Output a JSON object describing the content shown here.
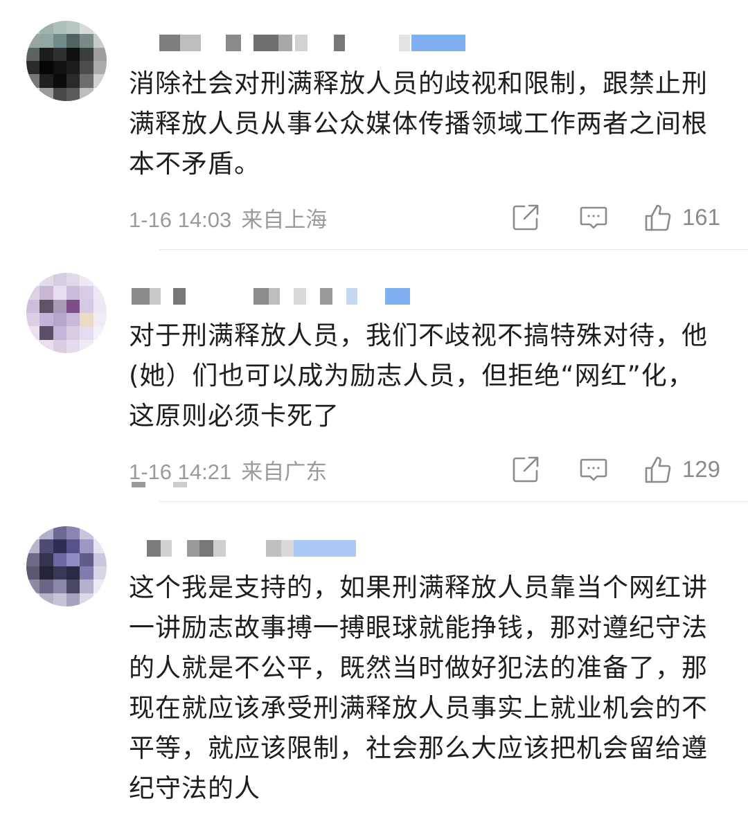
{
  "comments": [
    {
      "text": "消除社会对刑满释放人员的歧视和限制，跟禁止刑满释放人员从事公众媒体传播领域工作两者之间根本不矛盾。",
      "time": "1-16 14:03",
      "location": "来自上海",
      "likes": "161"
    },
    {
      "text": "对于刑满释放人员，我们不歧视不搞特殊对待，他(她）们也可以成为励志人员，但拒绝“网红”化，这原则必须卡死了",
      "time": "1-16 14:21",
      "location": "来自广东",
      "likes": "129"
    },
    {
      "text": "这个我是支持的，如果刑满释放人员靠当个网红讲一讲励志故事搏一搏眼球就能挣钱，那对遵纪守法的人就是不公平，既然当时做好犯法的准备了，那现在就应该承受刑满释放人员事实上就业机会的不平等，就应该限制，社会那么大应该把机会留给遵纪守法的人"
    }
  ],
  "icons": {
    "forward": "share-icon",
    "reply": "comment-icon",
    "like": "thumb-up-icon"
  },
  "colors": {
    "text": "#1e1e1e",
    "meta": "#9a9a9a",
    "icon": "#8a8a8a",
    "divider": "#e6e6e6",
    "blur_blue": "#7fb0ef"
  }
}
